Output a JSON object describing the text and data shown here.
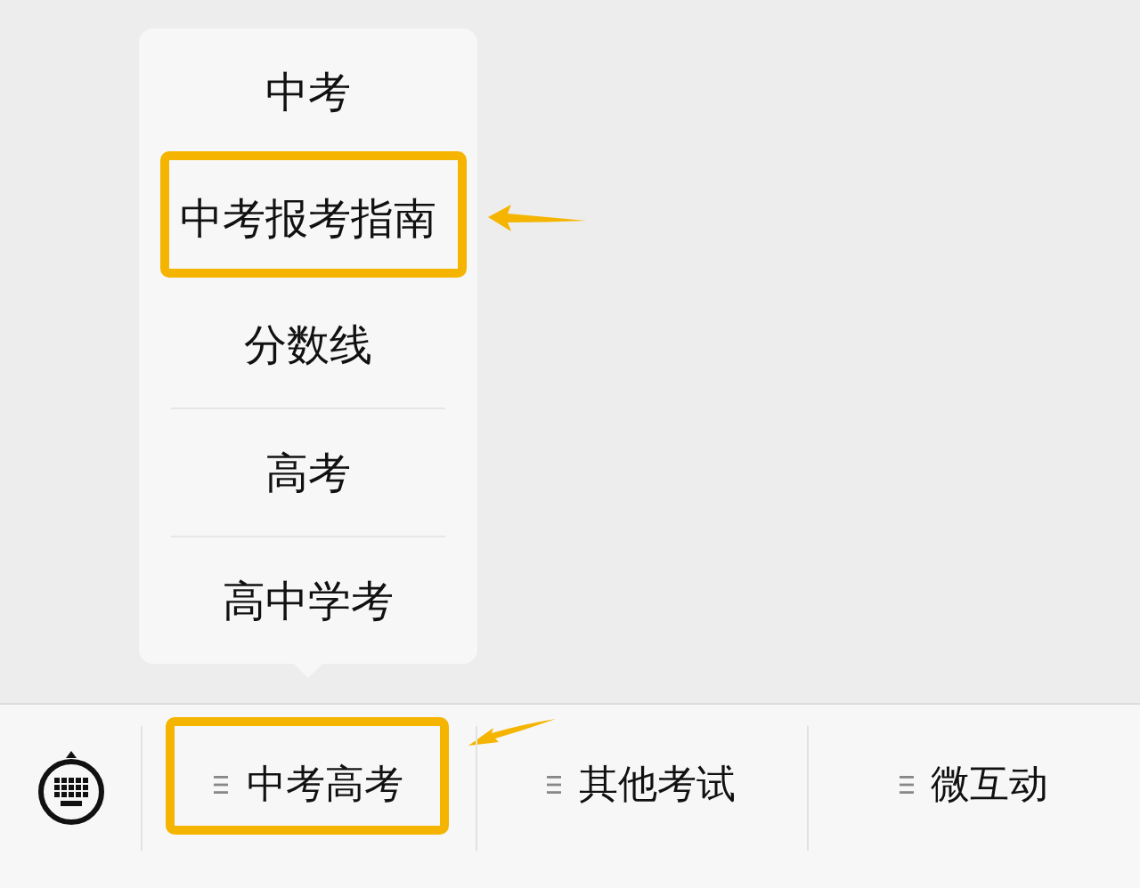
{
  "submenu": {
    "items": [
      {
        "label": "中考",
        "highlighted": false
      },
      {
        "label": "中考报考指南",
        "highlighted": true
      },
      {
        "label": "分数线",
        "highlighted": false
      },
      {
        "label": "高考",
        "highlighted": false
      },
      {
        "label": "高中学考",
        "highlighted": false
      }
    ]
  },
  "menu_bar": {
    "items": [
      {
        "label": "中考高考",
        "highlighted": true
      },
      {
        "label": "其他考试",
        "highlighted": false
      },
      {
        "label": "微互动",
        "highlighted": false
      }
    ]
  }
}
